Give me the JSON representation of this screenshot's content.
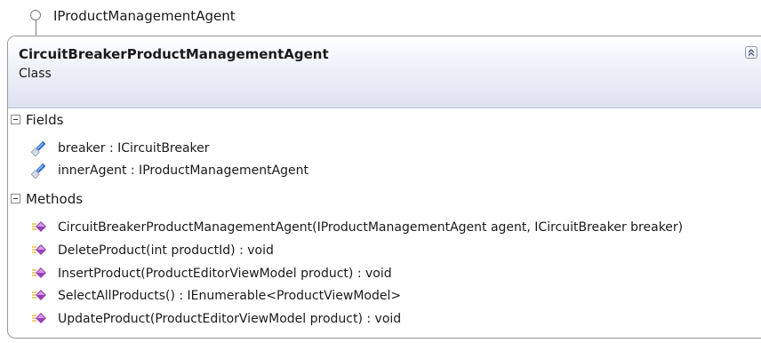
{
  "interface": {
    "name": "IProductManagementAgent"
  },
  "class": {
    "name": "CircuitBreakerProductManagementAgent",
    "kind": "Class"
  },
  "fields": {
    "title": "Fields",
    "items": [
      {
        "text": "breaker : ICircuitBreaker",
        "icon": "field-icon"
      },
      {
        "text": "innerAgent : IProductManagementAgent",
        "icon": "field-icon"
      }
    ]
  },
  "methods": {
    "title": "Methods",
    "items": [
      {
        "text": "CircuitBreakerProductManagementAgent(IProductManagementAgent agent, ICircuitBreaker breaker)",
        "icon": "method-icon"
      },
      {
        "text": "DeleteProduct(int productId) : void",
        "icon": "method-icon"
      },
      {
        "text": "InsertProduct(ProductEditorViewModel product) : void",
        "icon": "method-icon"
      },
      {
        "text": "SelectAllProducts() : IEnumerable<ProductViewModel>",
        "icon": "method-icon"
      },
      {
        "text": "UpdateProduct(ProductEditorViewModel product) : void",
        "icon": "method-icon"
      }
    ]
  },
  "colors": {
    "header_gradient_end": "#dde2f1",
    "border": "#9a9a9a",
    "field_icon": "#2f6fd0",
    "method_icon": "#9b3fb5"
  }
}
